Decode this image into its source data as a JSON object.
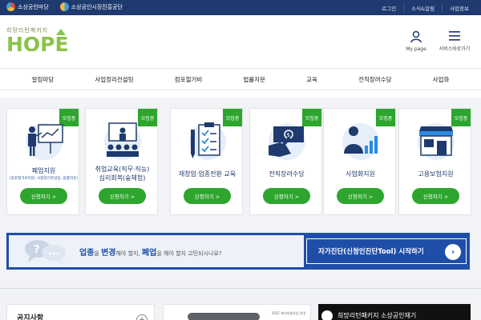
{
  "topbar": {
    "brand_left": "소상공인마당",
    "brand_right": "소상공인시장진흥공단",
    "links": [
      "로그인",
      "소식&알림",
      "사업정보"
    ]
  },
  "header": {
    "logo_sub": "희망리턴패키지",
    "logo_main": "HOPE",
    "mypage_label": "My page",
    "menu_label": "서비스바로가기"
  },
  "gnb": {
    "items": [
      "알림마당",
      "사업정리컨설팅",
      "점포철거비",
      "법률자문",
      "교육",
      "전직장려수당",
      "사업화"
    ]
  },
  "cards": [
    {
      "badge": "모집중",
      "title": "폐업지원",
      "sub": "(점포철거비지원, 사업정리컨설팅, 법률자문)",
      "button": "신청하기 >"
    },
    {
      "badge": "모집중",
      "title": "취업교육(직무·직능)\n심리회복(숲체험)",
      "button": "신청하기 >"
    },
    {
      "badge": "모집중",
      "title": "재창업·업종전환 교육",
      "button": "신청하기 >"
    },
    {
      "badge": "모집중",
      "title": "전직장려수당",
      "button": "신청하기 >"
    },
    {
      "badge": "모집중",
      "title": "사업화지원",
      "button": "신청하기 >"
    },
    {
      "badge": "모집중",
      "title": "고용보험지원",
      "button": "신청하기 >"
    }
  ],
  "banner": {
    "t1": "업종",
    "t2": "을 ",
    "t3": "변경",
    "t4": "해야 할지, ",
    "t5": "폐업",
    "t6": "을 해야 할지 고민되시나요?",
    "button": "자가진단(신청인진단Tool) 시작하기",
    "arrow": "›"
  },
  "bottom": {
    "notice_title": "공지사항",
    "notice_plus": "+",
    "doc_head": "2021 재기지원사업 안내",
    "video_title": "희망리턴패키지 소상공인재기"
  },
  "colors": {
    "navy": "#1e3a6e",
    "green": "#2ea52e",
    "banner_blue": "#1f4ea8",
    "logo_green": "#8bc34a"
  }
}
